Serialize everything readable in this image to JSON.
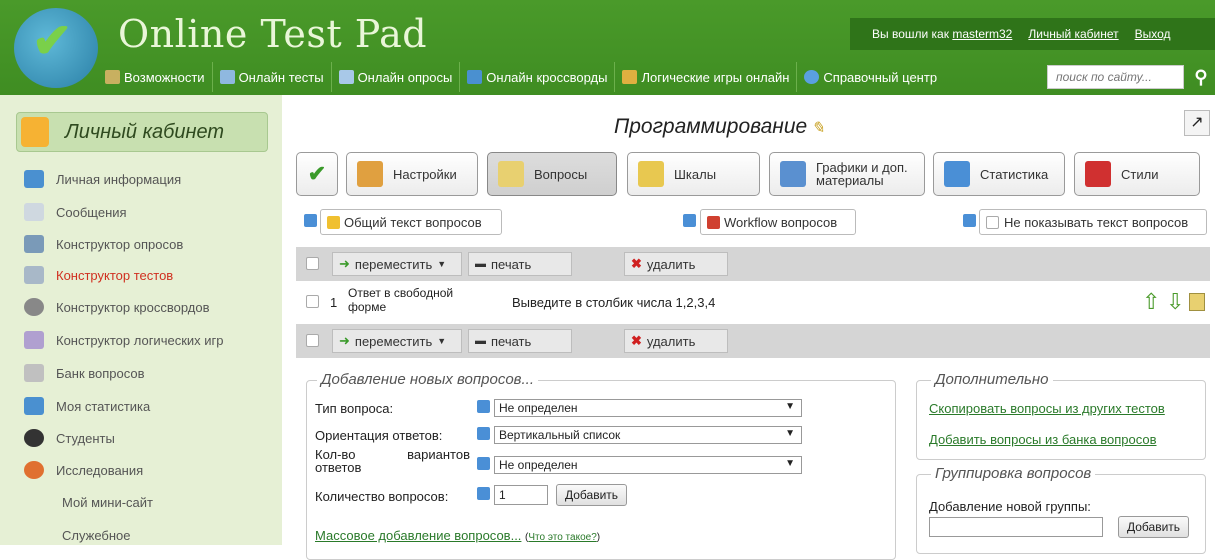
{
  "brand": "Online Test Pad",
  "top_right": {
    "logged_in_text": "Вы вошли как",
    "username": "masterm32",
    "cabinet_link": "Личный кабинет",
    "logout_link": "Выход"
  },
  "nav": [
    {
      "label": "Возможности",
      "icon": "gear-icon",
      "color": "#c8b060"
    },
    {
      "label": "Онлайн тесты",
      "icon": "test-icon",
      "color": "#8fb8e0"
    },
    {
      "label": "Онлайн опросы",
      "icon": "poll-icon",
      "color": "#a8c8e8"
    },
    {
      "label": "Онлайн кроссворды",
      "icon": "crossword-icon",
      "color": "#4a90d0"
    },
    {
      "label": "Логические игры онлайн",
      "icon": "puzzle-icon",
      "color": "#e0b040"
    },
    {
      "label": "Справочный центр",
      "icon": "help-icon",
      "color": "#5aa0e0"
    }
  ],
  "search": {
    "placeholder": "поиск по сайту..."
  },
  "sidebar": {
    "title": "Личный кабинет",
    "items": [
      {
        "label": "Личная информация",
        "color": "#4a90d0"
      },
      {
        "label": "Сообщения",
        "color": "#cfd8e0"
      },
      {
        "label": "Конструктор опросов",
        "color": "#7a9ab8"
      },
      {
        "label": "Конструктор тестов",
        "color": "#a8b8c8",
        "active": true
      },
      {
        "label": "Конструктор кроссвордов",
        "color": "#888"
      },
      {
        "label": "Конструктор логических игр",
        "color": "#b0a0d0"
      },
      {
        "label": "Банк вопросов",
        "color": "#c0c0c0"
      },
      {
        "label": "Моя статистика",
        "color": "#4a90d0"
      },
      {
        "label": "Студенты",
        "color": "#333"
      },
      {
        "label": "Исследования",
        "color": "#e07030"
      },
      {
        "label": "Мой мини-сайт"
      },
      {
        "label": "Служебное"
      }
    ]
  },
  "page_title": "Программирование",
  "toolbar": [
    {
      "label": "",
      "icon": "check-icon",
      "color": "#3a9a2a"
    },
    {
      "label": "Настройки",
      "icon": "tools-icon",
      "color": "#e0a040"
    },
    {
      "label": "Вопросы",
      "icon": "notepad-icon",
      "color": "#e8d070",
      "active": true
    },
    {
      "label": "Шкалы",
      "icon": "ruler-icon",
      "color": "#e8c850"
    },
    {
      "label": "Графики и доп. материалы",
      "icon": "chart-icon",
      "color": "#5a90d0"
    },
    {
      "label": "Статистика",
      "icon": "stats-icon",
      "color": "#4a8fd6"
    },
    {
      "label": "Стили",
      "icon": "css-icon",
      "color": "#d03030"
    }
  ],
  "sub_buttons": {
    "all_text": "Общий текст вопросов",
    "workflow": "Workflow вопросов",
    "hide_text": "Не показывать текст вопросов"
  },
  "actions": {
    "move": "переместить",
    "print": "печать",
    "delete": "удалить"
  },
  "question": {
    "number": "1",
    "type": "Ответ в свободной форме",
    "text": "Выведите в столбик числа 1,2,3,4"
  },
  "add_section": {
    "legend": "Добавление новых вопросов...",
    "type_label": "Тип вопроса:",
    "type_value": "Не определен",
    "orientation_label": "Ориентация ответов:",
    "orientation_value": "Вертикальный список",
    "variants_label": "Кол-во вариантов ответов",
    "variants_value": "Не определен",
    "count_label": "Количество вопросов:",
    "count_value": "1",
    "add_button": "Добавить",
    "mass_link": "Массовое добавление вопросов...",
    "what_link": "Что это такое?"
  },
  "extra": {
    "legend": "Дополнительно",
    "copy_link": "Скопировать вопросы из других тестов",
    "bank_link": "Добавить вопросы из банка вопросов"
  },
  "group": {
    "legend": "Группировка вопросов",
    "label": "Добавление новой группы:",
    "add_button": "Добавить"
  }
}
